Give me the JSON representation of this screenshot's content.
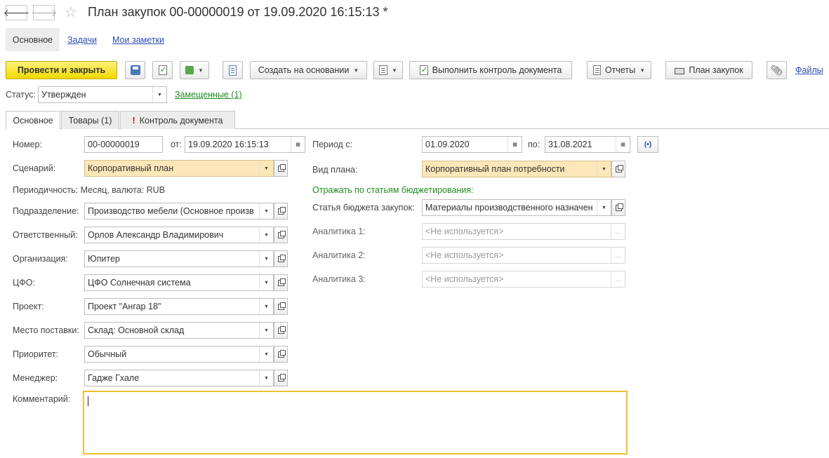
{
  "window": {
    "title": "План закупок 00-00000019 от 19.09.2020 16:15:13 *",
    "back_icon": "arrow-left-icon",
    "forward_icon": "arrow-right-icon",
    "favorite_icon": "star-icon"
  },
  "sections": {
    "active": "Основное",
    "tasks": "Задачи",
    "notes": "Мои заметки"
  },
  "toolbar": {
    "post_close": "Провести и закрыть",
    "create_based": "Создать на основании",
    "check_doc": "Выполнить контроль документа",
    "reports": "Отчеты",
    "purchase_plan": "План закупок",
    "files": "Файлы"
  },
  "status": {
    "label": "Статус:",
    "value": "Утвержден",
    "replaced_link": "Замещенные (1)"
  },
  "tabs": [
    "Основное",
    "Товары (1)",
    "Контроль документа"
  ],
  "form": {
    "number_label": "Номер:",
    "number": "00-00000019",
    "from_label": "от:",
    "date": "19.09.2020 16:15:13",
    "scenario_label": "Сценарий:",
    "scenario": "Корпоративный план",
    "periodicity": "Периодичность: Месяц, валюта: RUB",
    "department_label": "Подразделение:",
    "department": "Производство мебели (Основное произв",
    "responsible_label": "Ответственный:",
    "responsible": "Орлов Александр Владимирович",
    "organization_label": "Организация:",
    "organization": "Юпитер",
    "cfo_label": "ЦФО:",
    "cfo": "ЦФО Солнечная система",
    "project_label": "Проект:",
    "project": "Проект \"Ангар 18\"",
    "delivery_label": "Место поставки:",
    "delivery": "Склад: Основной склад",
    "priority_label": "Приоритет:",
    "priority": "Обычный",
    "manager_label": "Менеджер:",
    "manager": "Гадже Гхале",
    "comment_label": "Комментарий:",
    "comment": "",
    "period_from_label": "Период с:",
    "period_from": "01.09.2020",
    "period_to_label": "по:",
    "period_to": "31.08.2021",
    "plan_type_label": "Вид плана:",
    "plan_type": "Корпоративный план потребности",
    "budget_heading": "Отражать по статьям бюджетирования:",
    "budget_item_label": "Статья бюджета закупок:",
    "budget_item": "Материалы производственного назначен",
    "analytics1_label": "Аналитика 1:",
    "analytics2_label": "Аналитика 2:",
    "analytics3_label": "Аналитика 3:",
    "not_used": "<Не используется>"
  },
  "colors": {
    "primary_button": "#f3d900",
    "highlight_field": "#fde7b8",
    "link": "#2a4bb5",
    "green_link": "#1f8a1f",
    "comment_border": "#f0c030"
  }
}
